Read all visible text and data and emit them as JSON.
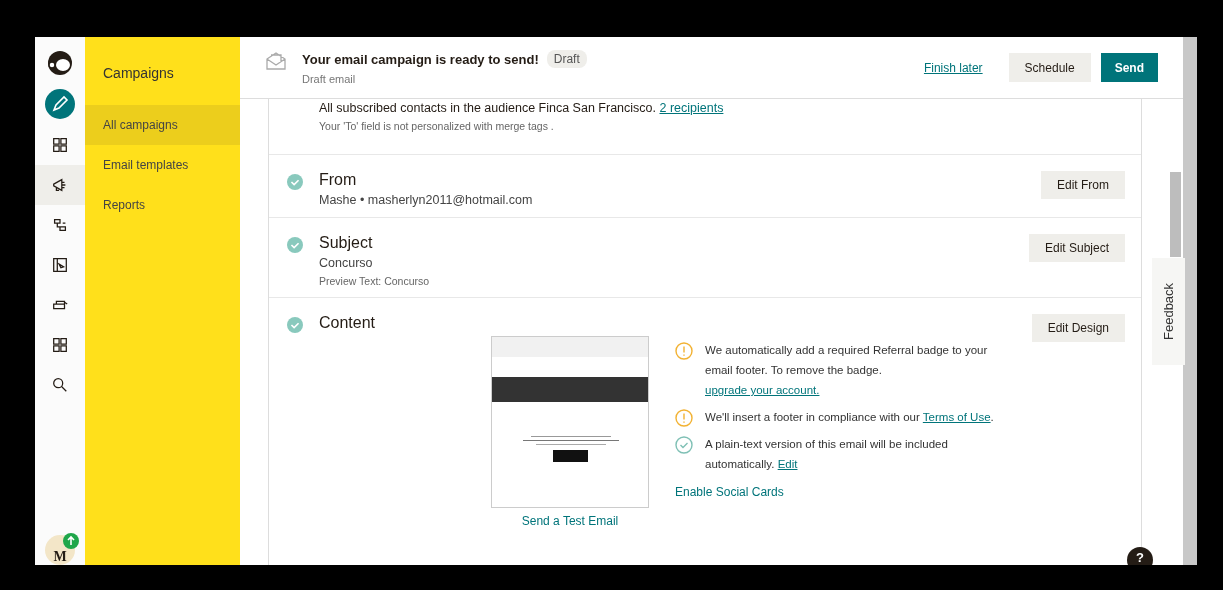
{
  "nav_rail": [
    {
      "selected": false
    },
    {
      "selected": true
    },
    {
      "selected": false
    },
    {
      "selected": false
    },
    {
      "selected": false
    },
    {
      "selected": false
    },
    {
      "selected": false
    }
  ],
  "avatar": {
    "initial": "M"
  },
  "sidebar": {
    "title": "Campaigns",
    "items": [
      {
        "label": "All campaigns",
        "selected": true
      },
      {
        "label": "Email templates",
        "selected": false
      },
      {
        "label": "Reports",
        "selected": false
      }
    ]
  },
  "header": {
    "title": "Your email campaign is ready to send!",
    "badge": "Draft",
    "subtitle": "Draft email",
    "link": "Finish later",
    "buttons": [
      {
        "label": "Schedule",
        "kind": "secondary"
      },
      {
        "label": "Send",
        "kind": "primary"
      }
    ]
  },
  "to_section": {
    "text": "All subscribed contacts in the audience Finca San Francisco.",
    "link": "2 recipients",
    "note": "Your 'To' field is not personalized with merge tags ."
  },
  "sections": [
    {
      "title": "From",
      "checked": true,
      "lines": [
        {
          "kind": "main",
          "text": "Mashe • masherlyn2011@hotmail.com"
        }
      ],
      "button": "Edit From"
    },
    {
      "title": "Subject",
      "checked": true,
      "lines": [
        {
          "kind": "main",
          "text": "Concurso"
        },
        {
          "kind": "note",
          "text": "Preview Text: Concurso"
        }
      ],
      "button": "Edit Subject"
    }
  ],
  "content": {
    "title": "Content",
    "checked": true,
    "button": "Edit Design",
    "test_link": "Send a Test Email",
    "social_link": "Enable Social Cards",
    "notices": [
      {
        "kind": "warning",
        "text": "We automatically add a required Referral badge to your email footer. To remove the badge.",
        "link": "upgrade your account."
      },
      {
        "kind": "warning",
        "text": "We'll insert a footer in compliance with our",
        "link": "Terms of Use",
        "after": "."
      },
      {
        "kind": "success",
        "text": "A plain-text version of this email will be included automatically.",
        "link": "Edit"
      }
    ]
  },
  "feedback": "Feedback",
  "help_button": "?"
}
